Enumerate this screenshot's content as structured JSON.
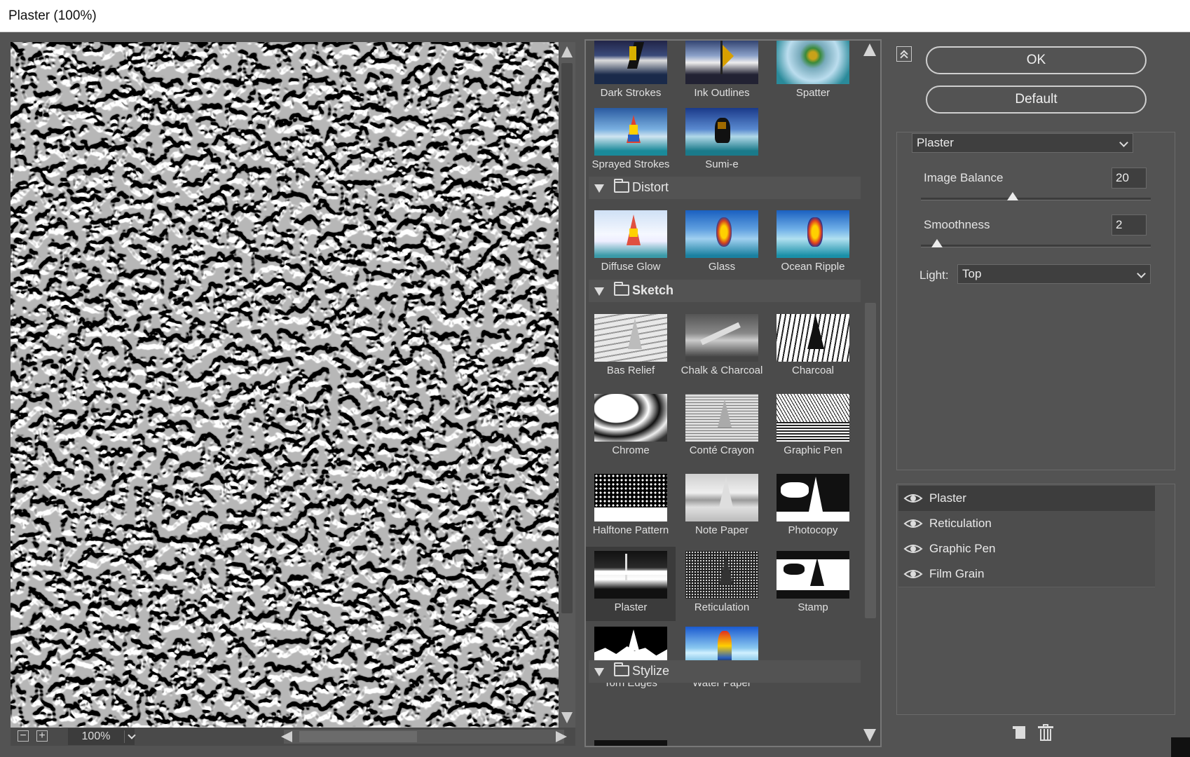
{
  "window": {
    "title": "Plaster (100%)"
  },
  "preview": {
    "zoom": "100%",
    "zoom_out": "−",
    "zoom_in": "+"
  },
  "gallery": {
    "top_row": [
      "Dark Strokes",
      "Ink Outlines",
      "Spatter"
    ],
    "second_row": [
      "Sprayed Strokes",
      "Sumi-e"
    ],
    "categories": [
      {
        "name": "Distort",
        "items": [
          "Diffuse Glow",
          "Glass",
          "Ocean Ripple"
        ]
      },
      {
        "name": "Sketch",
        "items": [
          "Bas Relief",
          "Chalk & Charcoal",
          "Charcoal",
          "Chrome",
          "Conté Crayon",
          "Graphic Pen",
          "Halftone Pattern",
          "Note Paper",
          "Photocopy",
          "Plaster",
          "Reticulation",
          "Stamp",
          "Torn Edges",
          "Water Paper"
        ]
      },
      {
        "name": "Stylize",
        "items": []
      }
    ],
    "selected": "Plaster"
  },
  "buttons": {
    "ok": "OK",
    "default": "Default"
  },
  "filter_select": {
    "value": "Plaster"
  },
  "params": {
    "image_balance": {
      "label": "Image Balance",
      "value": "20",
      "level": 0.4
    },
    "smoothness": {
      "label": "Smoothness",
      "value": "2",
      "level": 0.07
    },
    "light": {
      "label": "Light:",
      "value": "Top"
    }
  },
  "layers": [
    "Plaster",
    "Reticulation",
    "Graphic Pen",
    "Film Grain"
  ]
}
